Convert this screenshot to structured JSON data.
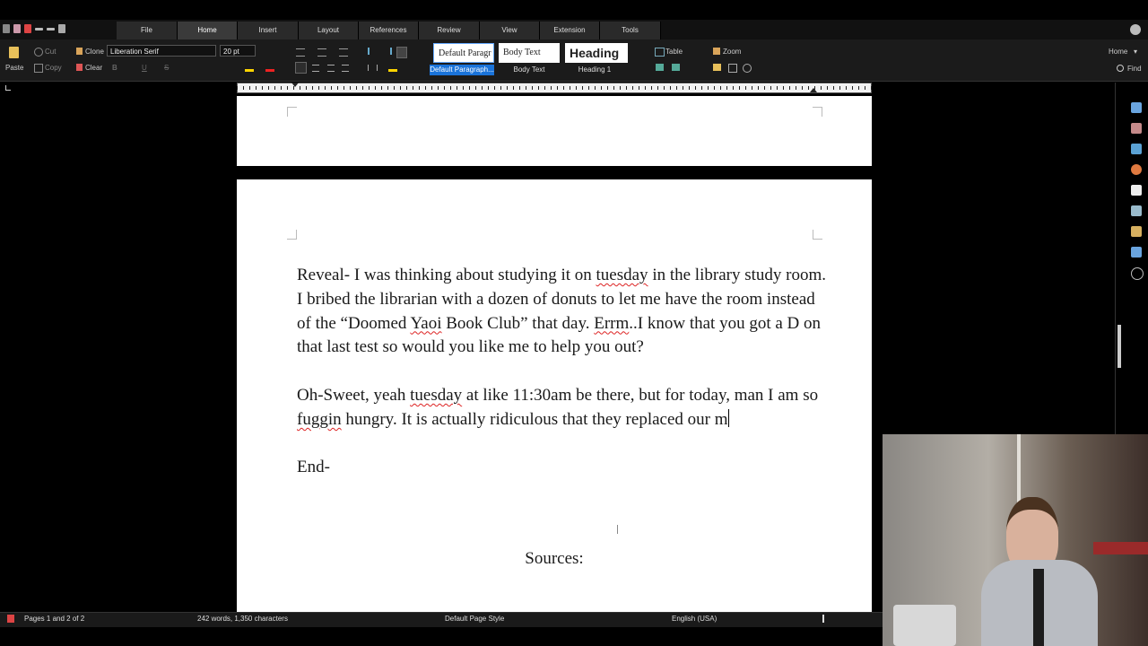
{
  "menu": {
    "tabs": [
      "File",
      "Home",
      "Insert",
      "Layout",
      "References",
      "Review",
      "View",
      "Extension",
      "Tools"
    ],
    "active": "Home"
  },
  "ribbon": {
    "paste": "Paste",
    "cut": "Cut",
    "copy": "Copy",
    "clone": "Clone",
    "clear": "Clear",
    "font_name": "Liberation Serif",
    "font_size": "20 pt",
    "styles": [
      {
        "preview": "Default Paragr",
        "caption": "Default Paragraph..."
      },
      {
        "preview": "Body Text",
        "caption": "Body Text"
      },
      {
        "preview": "Heading",
        "caption": "Heading 1"
      }
    ],
    "table": "Table",
    "zoom": "Zoom",
    "home_dropdown": "Home",
    "find": "Find"
  },
  "document": {
    "p1": {
      "a": "Reveal- I was thinking about studying it on ",
      "b": "tuesday",
      "c": " in the library study room. I bribed the librarian with a dozen of donuts to let me have the room instead of the “Doomed ",
      "d": "Yaoi",
      "e": " Book Club” that day. ",
      "f": "Errm",
      "g": "..I know that you got a D on that last test so would you like me to help you out?"
    },
    "p2": {
      "a": "Oh-Sweet, yeah ",
      "b": "tuesday",
      "c": " at like 11:30am be there, but for today, man I am so ",
      "d": "fuggin",
      "e": " hungry. It is actually ridiculous that they replaced our m"
    },
    "p3": "End-",
    "sources": "Sources:"
  },
  "statusbar": {
    "pages": "Pages 1 and 2 of 2",
    "words": "242 words, 1,350 characters",
    "page_style": "Default Page Style",
    "language": "English (USA)"
  },
  "colors": {
    "accent": "#1a73d9",
    "background": "#000000",
    "page": "#ffffff",
    "spelling": "#d22222"
  }
}
